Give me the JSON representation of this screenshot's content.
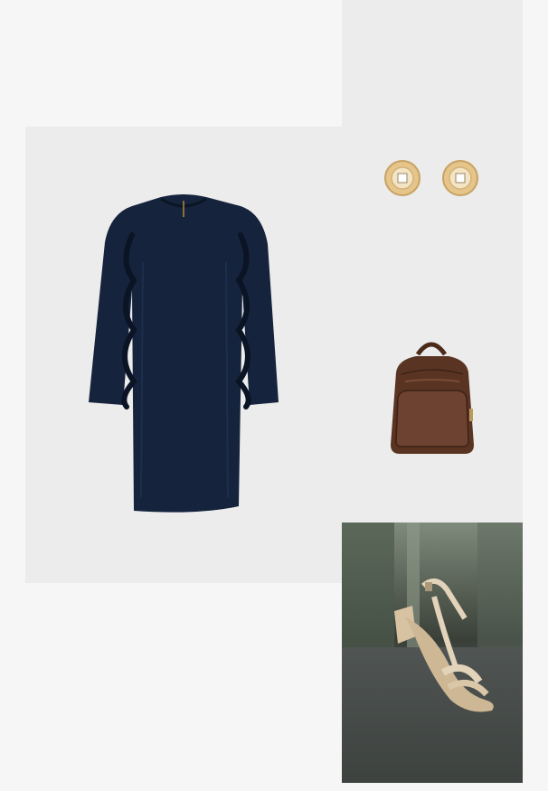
{
  "outfit": {
    "items": [
      {
        "id": "dress",
        "kind": "product-image",
        "color": "#15233c"
      },
      {
        "id": "earrings",
        "kind": "product-image",
        "color": "#e6c58a"
      },
      {
        "id": "backpack",
        "kind": "product-image",
        "color": "#5a3422"
      },
      {
        "id": "sandal",
        "kind": "product-image",
        "color": "#d7c2a2"
      }
    ]
  },
  "colors": {
    "page_bg": "#f6f6f6",
    "card_bg": "#ececec",
    "dress": "#15233c",
    "sandal_bg": "#2f3330"
  }
}
